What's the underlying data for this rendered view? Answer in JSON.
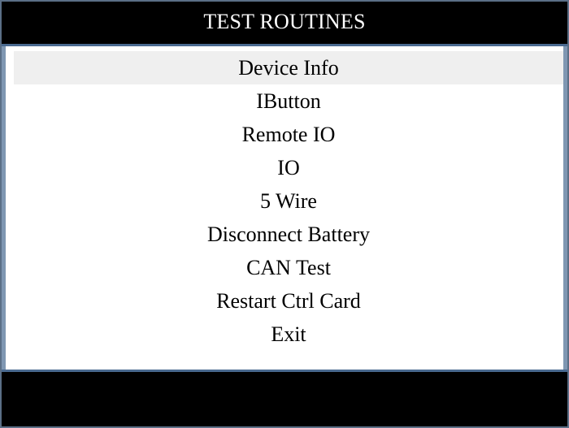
{
  "window": {
    "title": "TEST ROUTINES"
  },
  "menu": {
    "selected_index": 0,
    "items": [
      {
        "label": "Device Info"
      },
      {
        "label": "IButton"
      },
      {
        "label": "Remote IO"
      },
      {
        "label": "IO"
      },
      {
        "label": "5 Wire"
      },
      {
        "label": "Disconnect Battery"
      },
      {
        "label": "CAN Test"
      },
      {
        "label": "Restart Ctrl Card"
      },
      {
        "label": "Exit"
      }
    ]
  },
  "colors": {
    "title_bar": "#000000",
    "title_text": "#ffffff",
    "selected_row": "#efefef",
    "frame_border": "#7f97b2"
  }
}
